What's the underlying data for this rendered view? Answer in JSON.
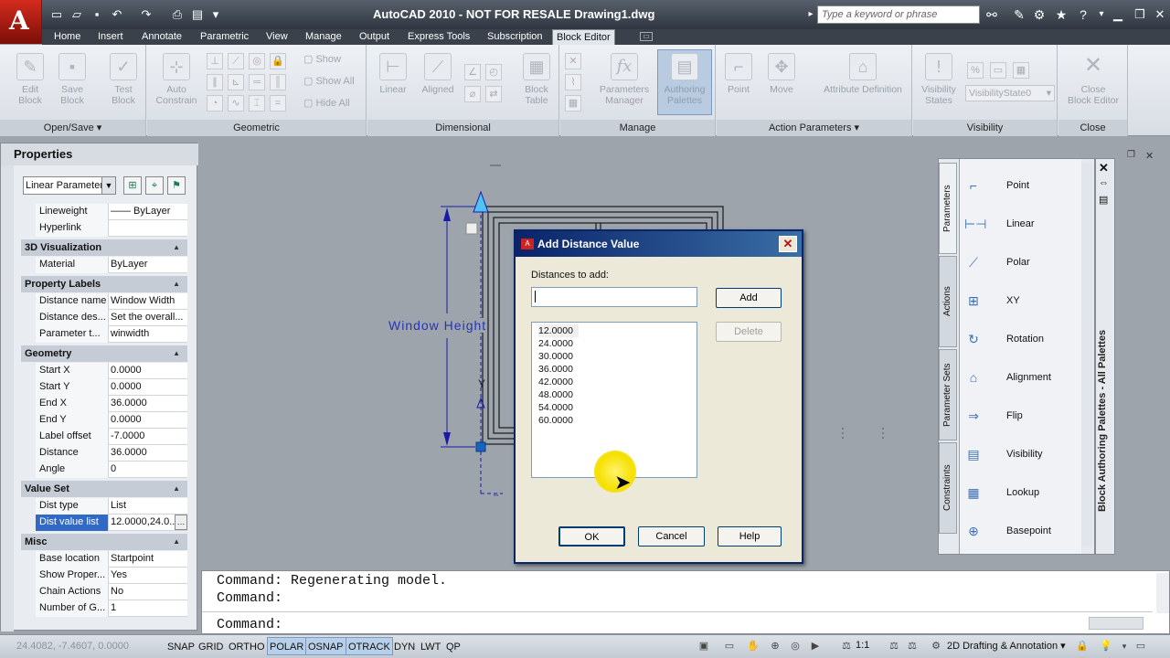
{
  "window": {
    "title": "AutoCAD 2010 - NOT FOR RESALE    Drawing1.dwg",
    "search_placeholder": "Type a keyword or phrase"
  },
  "tabs": [
    "Home",
    "Insert",
    "Annotate",
    "Parametric",
    "View",
    "Manage",
    "Output",
    "Express Tools",
    "Subscription",
    "Block Editor"
  ],
  "ribbon": {
    "open_save": {
      "title": "Open/Save",
      "edit_block": "Edit\nBlock",
      "save_block": "Save\nBlock",
      "test_block": "Test\nBlock"
    },
    "geometric": {
      "title": "Geometric",
      "auto_constrain": "Auto\nConstrain",
      "show": "Show",
      "show_all": "Show All",
      "hide_all": "Hide All"
    },
    "dimensional": {
      "title": "Dimensional",
      "linear": "Linear",
      "aligned": "Aligned"
    },
    "manage": {
      "title": "Manage",
      "block_table": "Block\nTable",
      "parameters_manager": "Parameters\nManager",
      "authoring_palettes": "Authoring\nPalettes"
    },
    "action_parameters": {
      "title": "Action Parameters",
      "point": "Point",
      "move": "Move",
      "attribute_definition": "Attribute Definition"
    },
    "visibility": {
      "title": "Visibility",
      "visibility_states": "Visibility\nStates",
      "state": "VisibilityState0"
    },
    "close": {
      "title": "Close",
      "close_block_editor": "Close\nBlock Editor"
    }
  },
  "properties": {
    "title": "Properties",
    "object": "Linear Parameter",
    "rows": {
      "lineweight": {
        "k": "Lineweight",
        "v": "—— ByLayer"
      },
      "hyperlink": {
        "k": "Hyperlink",
        "v": ""
      },
      "material": {
        "k": "Material",
        "v": "ByLayer"
      },
      "dist_name": {
        "k": "Distance name",
        "v": "Window Width"
      },
      "dist_desc": {
        "k": "Distance des...",
        "v": "Set the overall..."
      },
      "param_type": {
        "k": "Parameter t...",
        "v": "winwidth"
      },
      "start_x": {
        "k": "Start X",
        "v": "0.0000"
      },
      "start_y": {
        "k": "Start Y",
        "v": "0.0000"
      },
      "end_x": {
        "k": "End X",
        "v": "36.0000"
      },
      "end_y": {
        "k": "End Y",
        "v": "0.0000"
      },
      "label_offset": {
        "k": "Label offset",
        "v": "-7.0000"
      },
      "distance": {
        "k": "Distance",
        "v": "36.0000"
      },
      "angle": {
        "k": "Angle",
        "v": "0"
      },
      "dist_type": {
        "k": "Dist type",
        "v": "List"
      },
      "dist_value_list": {
        "k": "Dist value list",
        "v": "12.0000,24.0..."
      },
      "base_location": {
        "k": "Base location",
        "v": "Startpoint"
      },
      "show_properties": {
        "k": "Show Proper...",
        "v": "Yes"
      },
      "chain_actions": {
        "k": "Chain Actions",
        "v": "No"
      },
      "number_of_grips": {
        "k": "Number of G...",
        "v": "1"
      }
    },
    "sections": {
      "viz": "3D Visualization",
      "labels": "Property Labels",
      "geometry": "Geometry",
      "value_set": "Value Set",
      "misc": "Misc"
    }
  },
  "drawing": {
    "label": "Window Height"
  },
  "dialog": {
    "title": "Add Distance Value",
    "distances_label": "Distances to add:",
    "input_value": "",
    "add": "Add",
    "delete": "Delete",
    "ok": "OK",
    "cancel": "Cancel",
    "help": "Help",
    "values": [
      "12.0000",
      "24.0000",
      "30.0000",
      "36.0000",
      "42.0000",
      "48.0000",
      "54.0000",
      "60.0000"
    ]
  },
  "palette": {
    "tabs": [
      "Parameters",
      "Actions",
      "Parameter Sets",
      "Constraints"
    ],
    "items": [
      "Point",
      "Linear",
      "Polar",
      "XY",
      "Rotation",
      "Alignment",
      "Flip",
      "Visibility",
      "Lookup",
      "Basepoint"
    ],
    "side_title": "Block Authoring Palettes - All Palettes"
  },
  "command": {
    "lines": [
      "Command:  Regenerating model.",
      "Command:",
      "Command:"
    ]
  },
  "status": {
    "coords": "24.4082, -7.4607, 0.0000",
    "toggles": [
      {
        "label": "SNAP",
        "on": false
      },
      {
        "label": "GRID",
        "on": false
      },
      {
        "label": "ORTHO",
        "on": false
      },
      {
        "label": "POLAR",
        "on": true
      },
      {
        "label": "OSNAP",
        "on": true
      },
      {
        "label": "OTRACK",
        "on": true
      },
      {
        "label": "DYN",
        "on": false
      },
      {
        "label": "LWT",
        "on": false
      },
      {
        "label": "QP",
        "on": false
      }
    ],
    "scale": "1:1",
    "workspace": "2D Drafting & Annotation"
  }
}
